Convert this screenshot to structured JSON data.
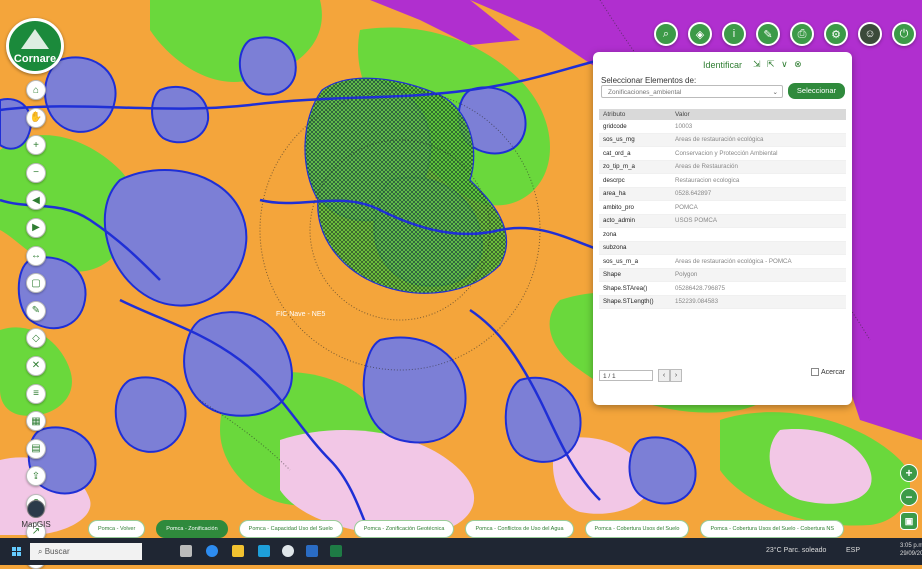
{
  "app": {
    "logo_text": "Cornare",
    "brand": "#2f8a3c"
  },
  "map": {
    "label_center": "FIC Nave - NE5",
    "colors": {
      "orange": "#f4a53b",
      "purple": "#b02fcf",
      "green": "#6ad83c",
      "blue": "#7c7fd6",
      "pink": "#f2c7e6",
      "outline": "#1f2fd6"
    }
  },
  "toolbar": {
    "icons": [
      "search-icon",
      "layers-icon",
      "info-icon",
      "measure-icon",
      "print-icon",
      "settings-icon",
      "user-icon",
      "exit-icon"
    ]
  },
  "left_tools": {
    "icons": [
      "home-icon",
      "hand-icon",
      "zoom-in-icon",
      "zoom-out-icon",
      "back-icon",
      "forward-icon",
      "ruler-icon",
      "area-icon",
      "draw-icon",
      "select-icon",
      "clear-icon",
      "legend-icon",
      "basemap-icon",
      "table-icon",
      "export-icon",
      "help-icon",
      "share-icon",
      "coordinates-icon"
    ]
  },
  "identify": {
    "title": "Identificar",
    "select_label": "Seleccionar Elementos de:",
    "select_value": "Zonificaciones_ambiental",
    "select_button": "Seleccionar",
    "table_headers": [
      "Atributo",
      "Valor"
    ],
    "rows": [
      [
        "gridcode",
        "10003"
      ],
      [
        "sos_us_mg",
        "Areas de restauración ecológica"
      ],
      [
        "cat_ord_a",
        "Conservacion y Protección Ambiental"
      ],
      [
        "zo_tip_m_a",
        "Areas de Restauración"
      ],
      [
        "descrpc",
        "Restauracion ecologica"
      ],
      [
        "area_ha",
        "0528.642897"
      ],
      [
        "ambito_pro",
        "POMCA"
      ],
      [
        "acto_admin",
        "USOS POMCA"
      ],
      [
        "zona",
        ""
      ],
      [
        "subzona",
        ""
      ],
      [
        "sos_us_m_a",
        "Areas de restauración ecológica - POMCA"
      ],
      [
        "Shape",
        "Polygon"
      ],
      [
        "Shape.STArea()",
        "05286428.796875"
      ],
      [
        "Shape.STLength()",
        "152239.084583"
      ]
    ],
    "pager": "1 / 1",
    "zoom_label": "Acercar"
  },
  "tabs": [
    {
      "label": "Pomca - Volver",
      "active": false
    },
    {
      "label": "Pomca - Zonificación",
      "active": true
    },
    {
      "label": "Pomca - Capacidad Uso del Suelo",
      "active": false
    },
    {
      "label": "Pomca - Zonificación Geotécnica",
      "active": false
    },
    {
      "label": "Pomca - Conflictos de Uso del Agua",
      "active": false
    },
    {
      "label": "Pomca - Cobertura Usos del Suelo",
      "active": false
    },
    {
      "label": "Pomca - Cobertura Usos del Suelo - Cobertura NS",
      "active": false
    }
  ],
  "mapgis_label": "MapGIS",
  "taskbar": {
    "search_placeholder": "Buscar",
    "weather": "23°C Parc. soleado",
    "tray": "ESP",
    "time": "3:05 p.m.",
    "date": "29/09/2022"
  }
}
